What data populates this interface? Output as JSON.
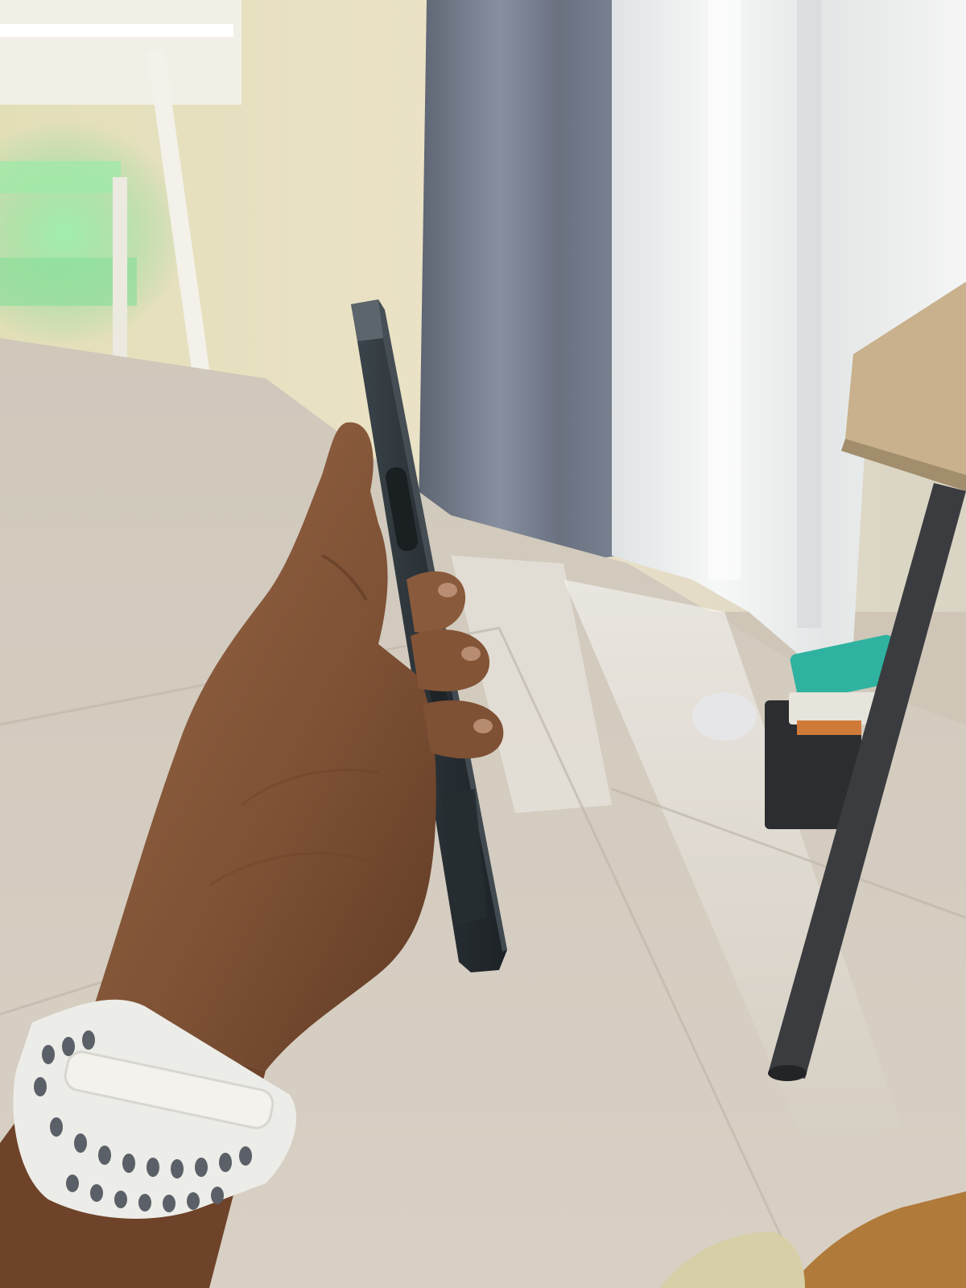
{
  "photo": {
    "subject": "hand-holding-phone-side-profile",
    "palette": {
      "wall": "#e9e2cf",
      "floor": "#d9d2c6",
      "floor_reflection": "#f4f1ea",
      "curtain_grey": "#6f7684",
      "curtain_sheer": "#eef0f0",
      "green_glow": "#7fe39a",
      "phone_body": "#2c3338",
      "phone_edge": "#4a545a",
      "skin": "#8a5a3c",
      "skin_shadow": "#5e3a24",
      "watch_band": "#ecece8",
      "watch_holes": "#5b6068",
      "table_top": "#c8b18c",
      "table_leg": "#3a3c40"
    }
  }
}
